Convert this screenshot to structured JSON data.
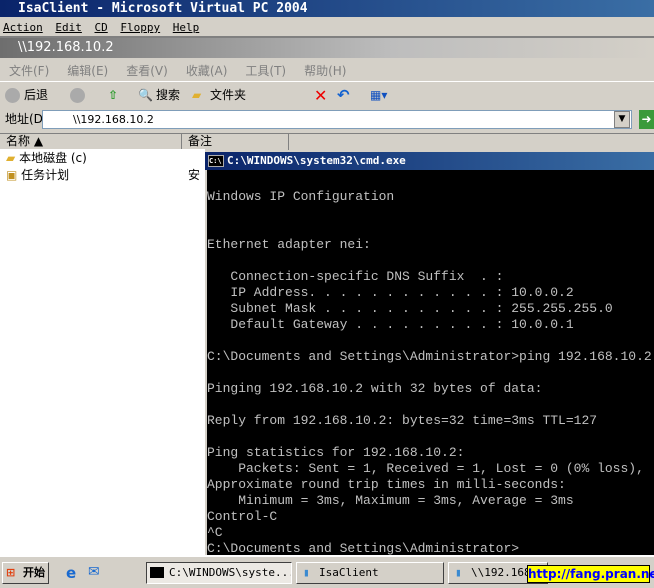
{
  "vpc": {
    "title": "IsaClient - Microsoft Virtual PC 2004",
    "menu": [
      "Action",
      "Edit",
      "CD",
      "Floppy",
      "Help"
    ]
  },
  "explorer": {
    "title": "\\\\192.168.10.2",
    "menu": [
      "文件(F)",
      "编辑(E)",
      "查看(V)",
      "收藏(A)",
      "工具(T)",
      "帮助(H)"
    ],
    "toolbar": {
      "back": "后退",
      "search": "搜索",
      "folders": "文件夹"
    },
    "address_label": "地址(D)",
    "address": "\\\\192.168.10.2",
    "columns": [
      "名称",
      "备注"
    ],
    "items": [
      {
        "name": "本地磁盘 (c)",
        "note": ""
      },
      {
        "name": "任务计划",
        "note": "安"
      }
    ]
  },
  "cmd": {
    "title": "C:\\WINDOWS\\system32\\cmd.exe",
    "lines": [
      "Windows IP Configuration",
      "",
      "",
      "Ethernet adapter nei:",
      "",
      "   Connection-specific DNS Suffix  . :",
      "   IP Address. . . . . . . . . . . . : 10.0.0.2",
      "   Subnet Mask . . . . . . . . . . . : 255.255.255.0",
      "   Default Gateway . . . . . . . . . : 10.0.0.1",
      "",
      "C:\\Documents and Settings\\Administrator>ping 192.168.10.2",
      "",
      "Pinging 192.168.10.2 with 32 bytes of data:",
      "",
      "Reply from 192.168.10.2: bytes=32 time=3ms TTL=127",
      "",
      "Ping statistics for 192.168.10.2:",
      "    Packets: Sent = 1, Received = 1, Lost = 0 (0% loss),",
      "Approximate round trip times in milli-seconds:",
      "    Minimum = 3ms, Maximum = 3ms, Average = 3ms",
      "Control-C",
      "^C",
      "C:\\Documents and Settings\\Administrator>"
    ]
  },
  "taskbar": {
    "start": "开始",
    "tasks": [
      "C:\\WINDOWS\\syste...",
      "IsaClient",
      "\\\\192.168."
    ]
  },
  "watermark": "http://fang.pran.net"
}
